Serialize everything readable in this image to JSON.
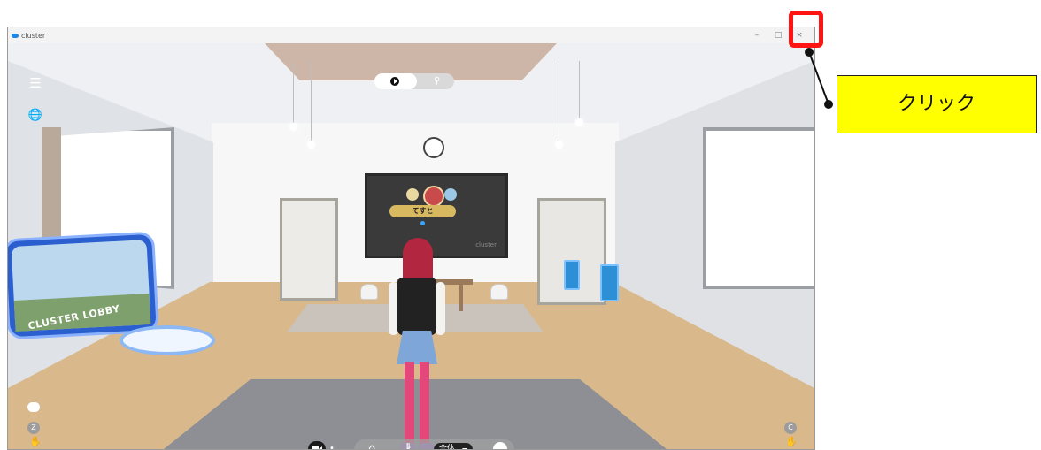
{
  "window": {
    "title": "cluster",
    "controls": {
      "minimize": "–",
      "maximize": "□",
      "close": "×"
    }
  },
  "toolbar_top": {
    "play_icon": "play-icon",
    "person_icon": "person-icon"
  },
  "left_controls": {
    "menu_icon": "☰",
    "globe_icon": "🌐"
  },
  "screen": {
    "display_name": "てすと",
    "logo_text": "cluster"
  },
  "lobby_card": {
    "label": "CLUSTER LOBBY"
  },
  "shortcut_keys": {
    "left": "Z",
    "right": "C"
  },
  "bottom_bar": {
    "scope_label": "全体"
  },
  "annotation": {
    "callout_text": "クリック",
    "highlight_color": "#ff1414",
    "callout_color": "#ffff00"
  }
}
